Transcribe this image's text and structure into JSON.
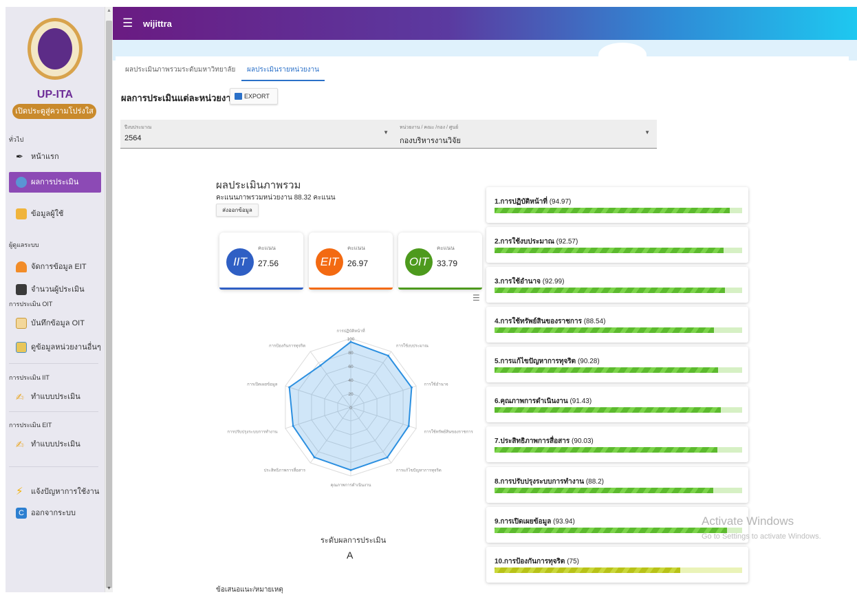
{
  "app": {
    "title": "wijittra",
    "brand": "UP-ITA",
    "brand_pill": "เปิดประตูสู่ความโปร่งใส"
  },
  "sidebar": {
    "section_general": "ทั่วไป",
    "item_home": "หน้าแรก",
    "item_results": "ผลการประเมิน",
    "item_userinfo": "ข้อมูลผู้ใช้",
    "section_admin": "ผู้ดูแลระบบ",
    "item_manage_eit": "จัดการข้อมูล EIT",
    "item_count": "จำนวนผู้ประเมิน",
    "section_oit": "การประเมิน OIT",
    "item_record_oit": "บันทึกข้อมูล OIT",
    "item_view_others": "ดูข้อมูลหน่วยงานอื่นๆ",
    "section_iit": "การประเมิน IIT",
    "item_do_iit": "ทำแบบประเมิน",
    "section_eit": "การประเมิน EIT",
    "item_do_eit": "ทำแบบประเมิน",
    "item_report": "แจ้งปัญหาการใช้งาน",
    "item_logout": "ออกจากระบบ"
  },
  "tabs": {
    "overall": "ผลประเมินภาพรวมระดับมหาวิทยาลัย",
    "unit": "ผลประเมินรายหน่วยงาน"
  },
  "main": {
    "heading": "ผลการประเมินแต่ละหน่วยงาน",
    "export_label": "EXPORT"
  },
  "filters": {
    "year_label": "ปีงบประมาณ",
    "year_value": "2564",
    "unit_label": "หน่วยงาน / คณะ /กอง / ศูนย์",
    "unit_value": "กองบริหารงานวิจัย"
  },
  "summary": {
    "title": "ผลประเมินภาพรวม",
    "subtitle": "คะแนนภาพรวมหน่วยงาน 88.32 คะแนน",
    "export_button": "ส่งออกข้อมูล",
    "score_label": "คะแนน",
    "iit": {
      "name": "IIT",
      "value": "27.56",
      "color": "#2f5fc4"
    },
    "eit": {
      "name": "EIT",
      "value": "26.97",
      "color": "#f36a12"
    },
    "oit": {
      "name": "OIT",
      "value": "33.79",
      "color": "#4d9a1d"
    },
    "level_title": "ระดับผลการประเมิน",
    "level_value": "A",
    "note_title": "ข้อเสนอแนะ/หมายเหตุ"
  },
  "radar": {
    "axes": [
      "การปฏิบัติหน้าที่",
      "การใช้งบประมาณ",
      "การใช้อำนาจ",
      "การใช้ทรัพย์สินของราชการ",
      "การแก้ไขปัญหาการทุจริต",
      "คุณภาพการดำเนินงาน",
      "ประสิทธิภาพการสื่อสาร",
      "การปรับปรุงระบบการทำงาน",
      "การเปิดเผยข้อมูล",
      "การป้องกันการทุจริต"
    ],
    "ticks": [
      "100",
      "80",
      "60",
      "40",
      "20",
      "0"
    ],
    "values": [
      94.97,
      92.57,
      92.99,
      88.54,
      90.28,
      91.43,
      90.03,
      88.2,
      93.94,
      75
    ],
    "color": "#2b8fe0"
  },
  "criteria": [
    {
      "name": "1.การปฏิบัติหน้าที่",
      "score": "(94.97)",
      "value": 94.97
    },
    {
      "name": "2.การใช้งบประมาณ",
      "score": "(92.57)",
      "value": 92.57
    },
    {
      "name": "3.การใช้อำนาจ",
      "score": "(92.99)",
      "value": 92.99
    },
    {
      "name": "4.การใช้ทรัพย์สินของราชการ",
      "score": "(88.54)",
      "value": 88.54
    },
    {
      "name": "5.การแก้ไขปัญหาการทุจริต",
      "score": "(90.28)",
      "value": 90.28
    },
    {
      "name": "6.คุณภาพการดำเนินงาน",
      "score": "(91.43)",
      "value": 91.43
    },
    {
      "name": "7.ประสิทธิภาพการสื่อสาร",
      "score": "(90.03)",
      "value": 90.03
    },
    {
      "name": "8.การปรับปรุงระบบการทำงาน",
      "score": "(88.2)",
      "value": 88.2
    },
    {
      "name": "9.การเปิดเผยข้อมูล",
      "score": "(93.94)",
      "value": 93.94
    },
    {
      "name": "10.การป้องกันการทุจริต",
      "score": "(75)",
      "value": 75
    }
  ],
  "watermark": {
    "line1": "Activate Windows",
    "line2": "Go to Settings to activate Windows."
  }
}
